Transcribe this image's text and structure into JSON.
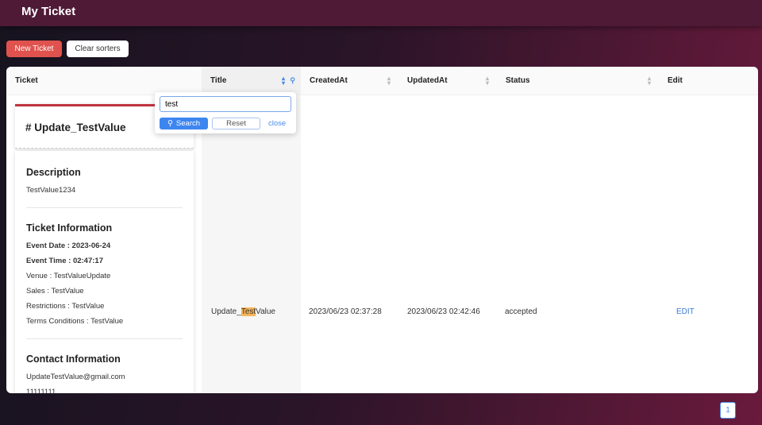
{
  "header": {
    "title": "My Ticket"
  },
  "toolbar": {
    "new_ticket": "New Ticket",
    "clear_sorters": "Clear sorters"
  },
  "table": {
    "columns": [
      "Ticket",
      "Title",
      "CreatedAt",
      "UpdatedAt",
      "Status",
      "Edit"
    ],
    "row": {
      "title_pre": "Update_",
      "title_hl": "Test",
      "title_post": "Value",
      "created": "2023/06/23 02:37:28",
      "updated": "2023/06/23 02:42:46",
      "status": "accepted",
      "edit": "EDIT"
    }
  },
  "ticket": {
    "name": "# Update_TestValue",
    "desc_h": "Description",
    "desc": "TestValue1234",
    "info_h": "Ticket Information",
    "event_date": "Event Date : 2023-06-24",
    "event_time": "Event Time : 02:47:17",
    "venue": "Venue : TestValueUpdate",
    "sales": "Sales : TestValue",
    "restrictions": "Restrictions : TestValue",
    "terms": "Terms Conditions : TestValue",
    "contact_h": "Contact Information",
    "email": "UpdateTestValue@gmail.com",
    "phone": "11111111"
  },
  "filter": {
    "value": "test",
    "search": "Search",
    "reset": "Reset",
    "close": "close"
  },
  "pagination": {
    "page": "1"
  }
}
